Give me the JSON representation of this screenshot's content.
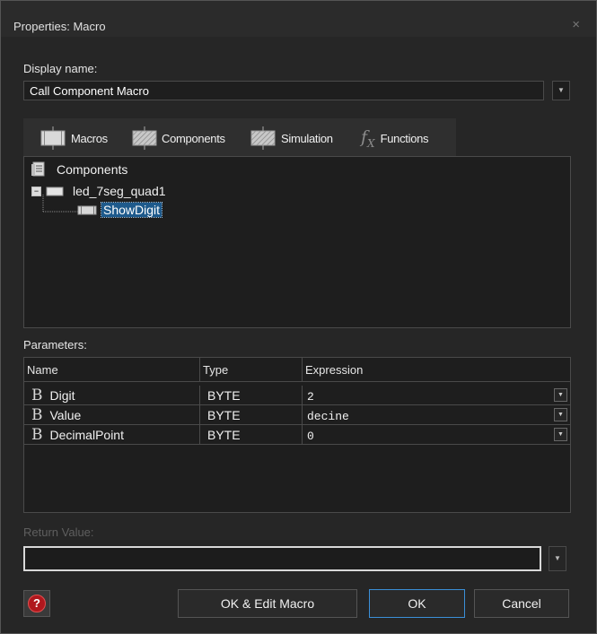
{
  "window": {
    "title": "Properties: Macro",
    "close_glyph": "×"
  },
  "display_name": {
    "label": "Display name:",
    "value": "Call Component Macro"
  },
  "tabs": [
    {
      "label": "Macros",
      "icon": "macro-block-icon"
    },
    {
      "label": "Components",
      "icon": "component-block-icon"
    },
    {
      "label": "Simulation",
      "icon": "simulation-block-icon"
    },
    {
      "label": "Functions",
      "icon": "fx-icon"
    }
  ],
  "tree": {
    "root": "Components",
    "node": "led_7seg_quad1",
    "leaf": "ShowDigit",
    "expander": "−"
  },
  "parameters": {
    "label": "Parameters:",
    "columns": [
      "Name",
      "Type",
      "Expression"
    ],
    "rows": [
      {
        "name": "Digit",
        "type": "BYTE",
        "expression": "2"
      },
      {
        "name": "Value",
        "type": "BYTE",
        "expression": "decine"
      },
      {
        "name": "DecimalPoint",
        "type": "BYTE",
        "expression": "0"
      }
    ],
    "type_glyph": "B"
  },
  "return_value": {
    "label": "Return Value:",
    "value": ""
  },
  "buttons": {
    "help": "?",
    "ok_edit": "OK & Edit Macro",
    "ok": "OK",
    "cancel": "Cancel"
  },
  "dropdown_glyph": "▼",
  "colors": {
    "accent": "#3b8fd8",
    "selection": "#1e5a8c",
    "help": "#b0171d"
  }
}
